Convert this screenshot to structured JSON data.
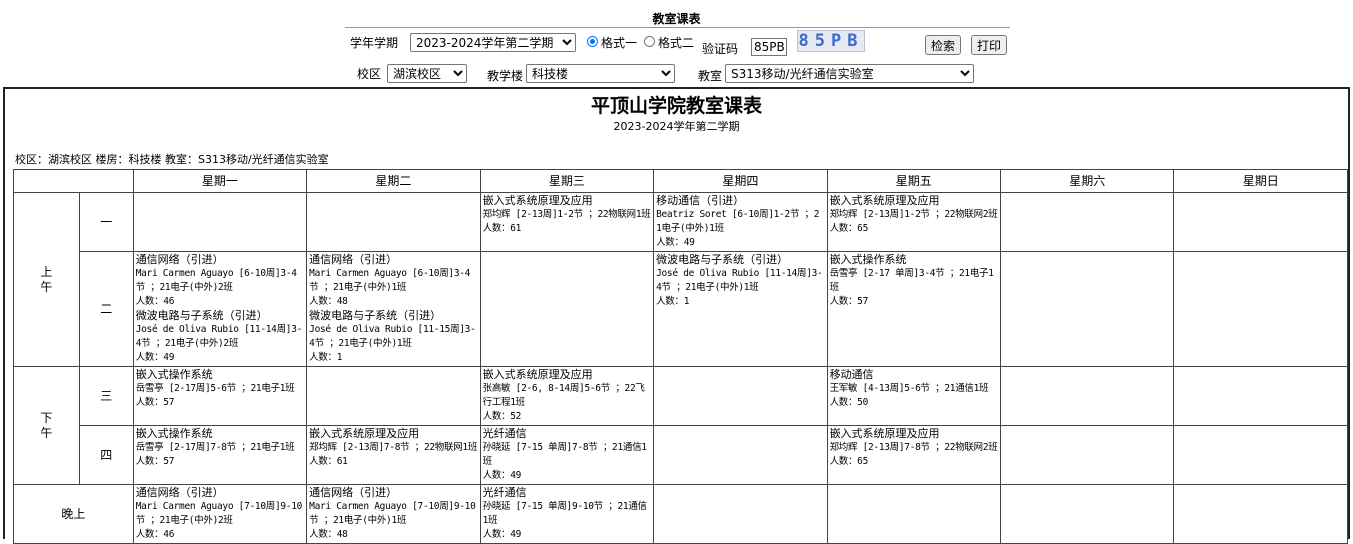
{
  "header": {
    "title": "教室课表",
    "term_label": "学年学期",
    "term_value": "2023-2024学年第二学期",
    "format1_label": "格式一",
    "format2_label": "格式二",
    "captcha_label": "验证码",
    "captcha_input": "85PB",
    "captcha_image_text": "85PB",
    "search_button": "检索",
    "print_button": "打印",
    "campus_label": "校区",
    "campus_value": "湖滨校区",
    "building_label": "教学楼",
    "building_value": "科技楼",
    "room_label": "教室",
    "room_value": "S313移动/光纤通信实验室"
  },
  "report": {
    "title": "平顶山学院教室课表",
    "term": "2023-2024学年第二学期",
    "info": "校区：湖滨校区   楼房：科技楼   教室：S313移动/光纤通信实验室",
    "days": [
      "星期一",
      "星期二",
      "星期三",
      "星期四",
      "星期五",
      "星期六",
      "星期日"
    ],
    "periods": [
      {
        "label": "上午",
        "sections": [
          "一",
          "二"
        ]
      },
      {
        "label": "下午",
        "sections": [
          "三",
          "四"
        ]
      },
      {
        "label": "晚上",
        "sections": []
      }
    ],
    "rows": [
      [
        [],
        [],
        [
          {
            "course": "嵌入式系统原理及应用",
            "detail": "郑均辉 [2-13周]1-2节 ；22物联网1班",
            "count": "人数：61"
          }
        ],
        [
          {
            "course": "移动通信（引进）",
            "detail": "Beatriz Soret [6-10周]1-2节 ；21电子(中外)1班",
            "count": "人数：49"
          }
        ],
        [
          {
            "course": "嵌入式系统原理及应用",
            "detail": "郑均辉 [2-13周]1-2节 ；22物联网2班",
            "count": "人数：65"
          }
        ],
        [],
        []
      ],
      [
        [
          {
            "course": "通信网络（引进）",
            "detail": "Mari Carmen Aguayo [6-10周]3-4节 ；21电子(中外)2班",
            "count": "人数：46"
          },
          {
            "course": "微波电路与子系统（引进）",
            "detail": "José de Oliva Rubio [11-14周]3-4节 ；21电子(中外)2班",
            "count": "人数：49"
          }
        ],
        [
          {
            "course": "通信网络（引进）",
            "detail": "Mari Carmen Aguayo [6-10周]3-4节 ；21电子(中外)1班",
            "count": "人数：48"
          },
          {
            "course": "微波电路与子系统（引进）",
            "detail": "José de Oliva Rubio [11-15周]3-4节 ；21电子(中外)1班",
            "count": "人数：1"
          }
        ],
        [],
        [
          {
            "course": "微波电路与子系统（引进）",
            "detail": "José de Oliva Rubio [11-14周]3-4节 ；21电子(中外)1班",
            "count": "人数：1"
          }
        ],
        [
          {
            "course": "嵌入式操作系统",
            "detail": "岳雪亭 [2-17 单周]3-4节 ；21电子1班",
            "count": "人数：57"
          }
        ],
        [],
        []
      ],
      [
        [
          {
            "course": "嵌入式操作系统",
            "detail": "岳雪亭 [2-17周]5-6节 ；21电子1班",
            "count": "人数：57"
          }
        ],
        [],
        [
          {
            "course": "嵌入式系统原理及应用",
            "detail": "张高敏 [2-6, 8-14周]5-6节 ；22飞行工程1班",
            "count": "人数：52"
          }
        ],
        [],
        [
          {
            "course": "移动通信",
            "detail": "王军敏 [4-13周]5-6节 ；21通信1班",
            "count": "人数：50"
          }
        ],
        [],
        []
      ],
      [
        [
          {
            "course": "嵌入式操作系统",
            "detail": "岳雪亭 [2-17周]7-8节 ；21电子1班",
            "count": "人数：57"
          }
        ],
        [
          {
            "course": "嵌入式系统原理及应用",
            "detail": "郑均辉 [2-13周]7-8节 ；22物联网1班",
            "count": "人数：61"
          }
        ],
        [
          {
            "course": "光纤通信",
            "detail": "孙晓延 [7-15 单周]7-8节 ；21通信1班",
            "count": "人数：49"
          }
        ],
        [],
        [
          {
            "course": "嵌入式系统原理及应用",
            "detail": "郑均辉 [2-13周]7-8节 ；22物联网2班",
            "count": "人数：65"
          }
        ],
        [],
        []
      ],
      [
        [
          {
            "course": "通信网络（引进）",
            "detail": "Mari Carmen Aguayo [7-10周]9-10节 ；21电子(中外)2班",
            "count": "人数：46"
          }
        ],
        [
          {
            "course": "通信网络（引进）",
            "detail": "Mari Carmen Aguayo [7-10周]9-10节 ；21电子(中外)1班",
            "count": "人数：48"
          }
        ],
        [
          {
            "course": "光纤通信",
            "detail": "孙晓延 [7-15 单周]9-10节 ；21通信1班",
            "count": "人数：49"
          }
        ],
        [],
        [],
        [],
        []
      ]
    ]
  }
}
